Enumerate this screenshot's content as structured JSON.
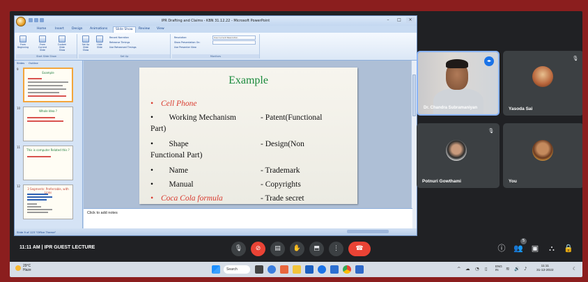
{
  "powerpoint": {
    "window_title": "IPR Drafting and Claims - KBN 31.12.22 - Microsoft PowerPoint",
    "tabs": [
      "Home",
      "Insert",
      "Design",
      "Animations",
      "Slide Show",
      "Review",
      "View"
    ],
    "active_tab": "Slide Show",
    "ribbon": {
      "from_beginning": "From Beginning",
      "from_current": "From Current Slide",
      "custom_show": "Custom Slide Show",
      "start_group": "Start Slide Show",
      "setup_show": "Set Up Slide Show",
      "hide_slide": "Hide Slide",
      "record_narration": "Record Narration",
      "rehearse": "Rehearse Timings",
      "use_rehearsed": "Use Rehearsed Timings",
      "setup_group": "Set Up",
      "resolution": "Resolution:",
      "resolution_value": "Use Current Resolution",
      "show_on": "Show Presentation On:",
      "presenter_view": "Use Presenter View",
      "monitors_group": "Monitors"
    },
    "left_tabs": [
      "Slides",
      "Outline"
    ],
    "thumbnails": [
      {
        "num": "9",
        "title": "Example"
      },
      {
        "num": "10",
        "title": "Whole Idea ?"
      },
      {
        "num": "11",
        "title": "This is computer Related this ?"
      },
      {
        "num": "12",
        "title": "3 Segments: Preferrable, with Links"
      }
    ],
    "slide": {
      "title": "Example",
      "rows": [
        {
          "left": "Cell Phone",
          "right": "",
          "red": true
        },
        {
          "left": "Working Mechanism",
          "right": "- Patent(Functional",
          "red": false
        },
        {
          "left": "Part)",
          "right": "",
          "red": false,
          "cont": true
        },
        {
          "left": "Shape",
          "right": "- Design(Non",
          "red": false
        },
        {
          "left": "Functional Part)",
          "right": "",
          "red": false,
          "cont": true
        },
        {
          "left": "Name",
          "right": "- Trademark",
          "red": false
        },
        {
          "left": "Manual",
          "right": "- Copyrights",
          "red": false
        },
        {
          "left": "Coca Cola formula",
          "right": "- Trade secret",
          "red": true
        }
      ]
    },
    "notes_placeholder": "Click to add notes",
    "status_text": "Slide 9 of 123    \"Office Theme\""
  },
  "participants": [
    {
      "name": "Dr. Chandra Subramaniyan",
      "role": "speaker"
    },
    {
      "name": "Yasoda Sai"
    },
    {
      "name": "Potnuri Gowthami"
    },
    {
      "name": "You"
    }
  ],
  "meet": {
    "time": "11:11 AM",
    "separator": "|",
    "meeting_name": "IPR GUEST LECTURE",
    "people_count": "5",
    "accent": "#8ab4f8",
    "end_color": "#ea4335"
  },
  "taskbar": {
    "temp": "29°C",
    "weather": "Haze",
    "search": "Search",
    "lang": "ENG",
    "region": "IN",
    "clock_time": "11:11",
    "clock_date": "31-12-2022"
  }
}
